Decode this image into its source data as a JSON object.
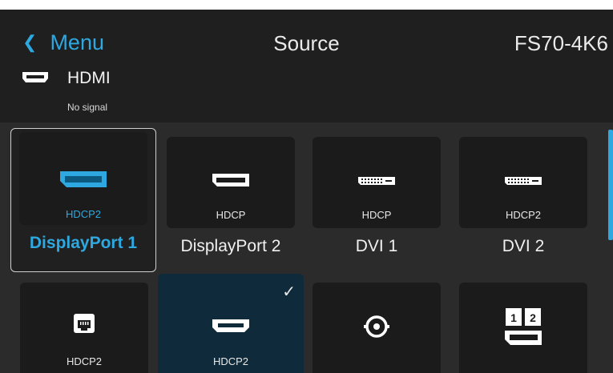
{
  "header": {
    "back_label": "Menu",
    "title": "Source",
    "model": "FS70-4K6"
  },
  "current_source": {
    "name": "HDMI",
    "status": "No signal",
    "icon": "hdmi-port-icon"
  },
  "sources": [
    {
      "label": "DisplayPort 1",
      "sub": "HDCP2",
      "icon": "displayport-icon",
      "selected": true
    },
    {
      "label": "DisplayPort 2",
      "sub": "HDCP",
      "icon": "displayport-icon"
    },
    {
      "label": "DVI 1",
      "sub": "HDCP",
      "icon": "dvi-icon"
    },
    {
      "label": "DVI 2",
      "sub": "HDCP2",
      "icon": "dvi-icon"
    },
    {
      "label": "",
      "sub": "HDCP2",
      "icon": "hdbaset-icon"
    },
    {
      "label": "",
      "sub": "HDCP2",
      "icon": "hdmi-port-icon",
      "active": true
    },
    {
      "label": "",
      "sub": "",
      "icon": "sdi-bnc-icon"
    },
    {
      "label": "",
      "sub": "",
      "icon": "dual-displayport-icon"
    }
  ],
  "colors": {
    "accent": "#2ea8e0",
    "header_bg": "#1f1f1f",
    "tile_bg": "#1b1b1b",
    "active_bg": "#0f2a3a"
  }
}
